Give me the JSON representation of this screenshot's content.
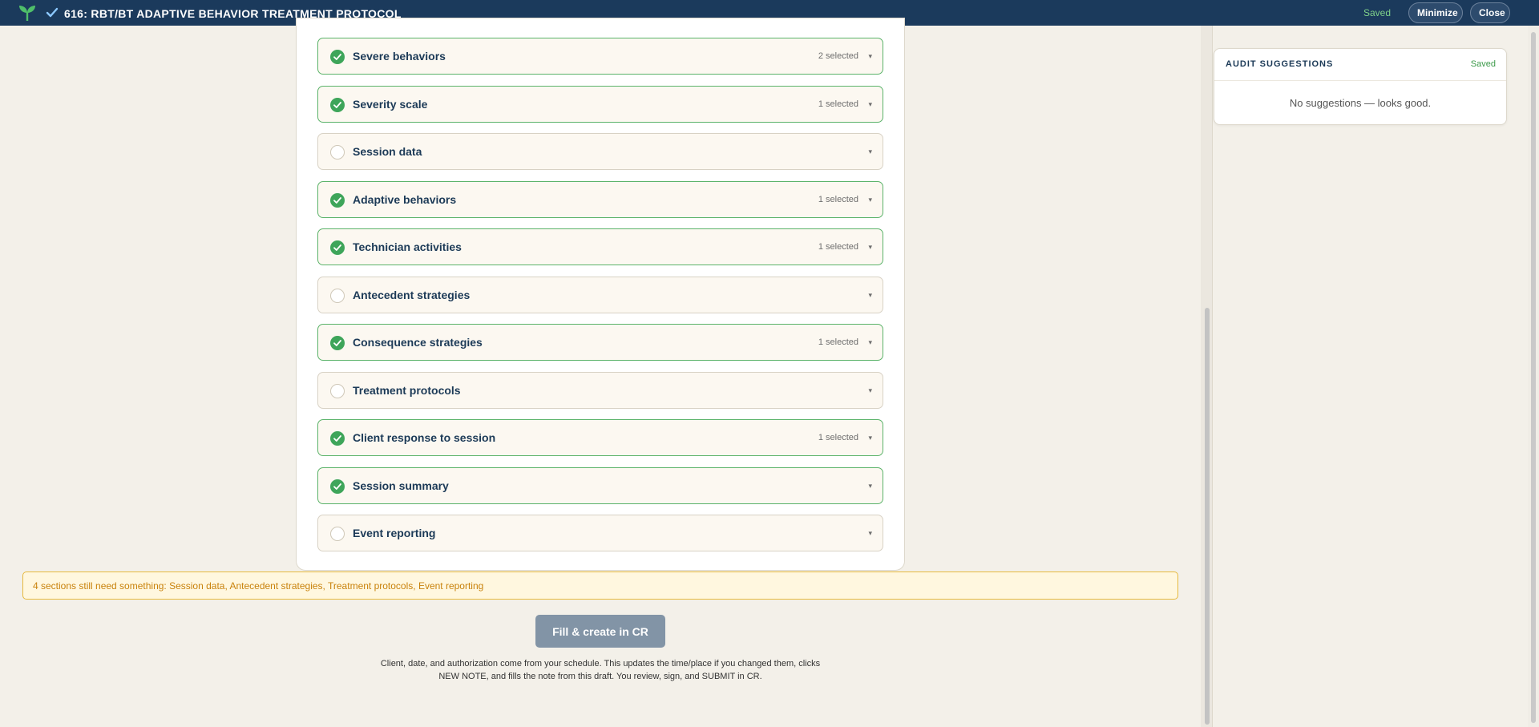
{
  "header": {
    "title": "616: RBT/BT ADAPTIVE BEHAVIOR TREATMENT PROTOCOL",
    "saved_label": "Saved",
    "minimize_label": "Minimize",
    "close_label": "Close"
  },
  "sections": [
    {
      "label": "Severe behaviors",
      "count": "2 selected",
      "done": true
    },
    {
      "label": "Severity scale",
      "count": "1 selected",
      "done": true
    },
    {
      "label": "Session data",
      "count": "",
      "done": false
    },
    {
      "label": "Adaptive behaviors",
      "count": "1 selected",
      "done": true
    },
    {
      "label": "Technician activities",
      "count": "1 selected",
      "done": true
    },
    {
      "label": "Antecedent strategies",
      "count": "",
      "done": false
    },
    {
      "label": "Consequence strategies",
      "count": "1 selected",
      "done": true
    },
    {
      "label": "Treatment protocols",
      "count": "",
      "done": false
    },
    {
      "label": "Client response to session",
      "count": "1 selected",
      "done": true
    },
    {
      "label": "Session summary",
      "count": "",
      "done": true
    },
    {
      "label": "Event reporting",
      "count": "",
      "done": false
    }
  ],
  "warning": "4 sections still need something: Session data, Antecedent strategies, Treatment protocols, Event reporting",
  "fill_button": "Fill & create in CR",
  "help": {
    "line1": "Client, date, and authorization come from your schedule. This updates the time/place if you changed them, clicks",
    "line2": "NEW NOTE, and fills the note from this draft. You review, sign, and SUBMIT in CR."
  },
  "audit": {
    "title": "AUDIT SUGGESTIONS",
    "saved_label": "Saved",
    "empty": "No suggestions — looks good."
  },
  "colors": {
    "header_bg": "#1b3a5c",
    "done_green": "#3ea55a",
    "warn_text": "#c9820c",
    "button_bg": "#8294a6"
  }
}
